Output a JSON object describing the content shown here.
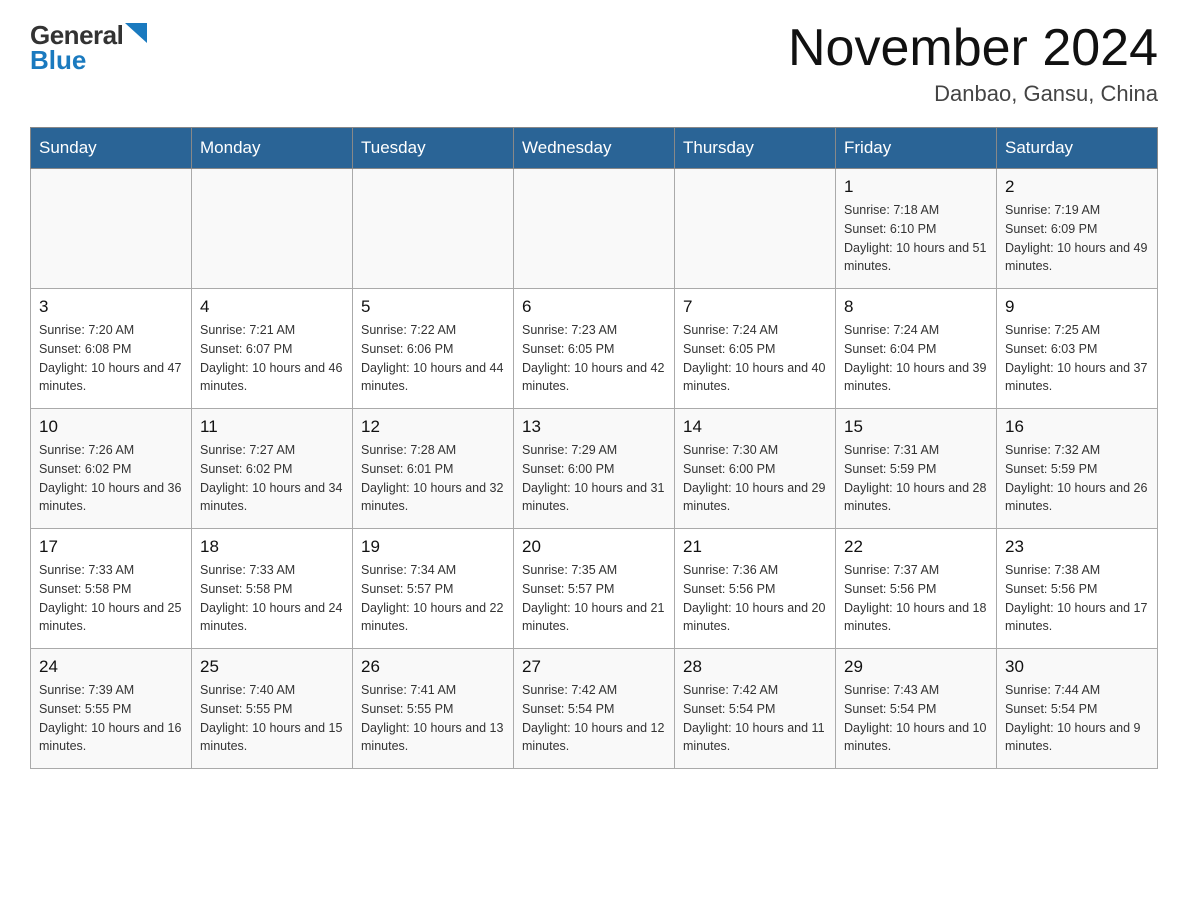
{
  "header": {
    "logo_general": "General",
    "logo_blue": "Blue",
    "month_title": "November 2024",
    "location": "Danbao, Gansu, China"
  },
  "weekdays": [
    "Sunday",
    "Monday",
    "Tuesday",
    "Wednesday",
    "Thursday",
    "Friday",
    "Saturday"
  ],
  "weeks": [
    [
      {
        "day": "",
        "info": ""
      },
      {
        "day": "",
        "info": ""
      },
      {
        "day": "",
        "info": ""
      },
      {
        "day": "",
        "info": ""
      },
      {
        "day": "",
        "info": ""
      },
      {
        "day": "1",
        "info": "Sunrise: 7:18 AM\nSunset: 6:10 PM\nDaylight: 10 hours and 51 minutes."
      },
      {
        "day": "2",
        "info": "Sunrise: 7:19 AM\nSunset: 6:09 PM\nDaylight: 10 hours and 49 minutes."
      }
    ],
    [
      {
        "day": "3",
        "info": "Sunrise: 7:20 AM\nSunset: 6:08 PM\nDaylight: 10 hours and 47 minutes."
      },
      {
        "day": "4",
        "info": "Sunrise: 7:21 AM\nSunset: 6:07 PM\nDaylight: 10 hours and 46 minutes."
      },
      {
        "day": "5",
        "info": "Sunrise: 7:22 AM\nSunset: 6:06 PM\nDaylight: 10 hours and 44 minutes."
      },
      {
        "day": "6",
        "info": "Sunrise: 7:23 AM\nSunset: 6:05 PM\nDaylight: 10 hours and 42 minutes."
      },
      {
        "day": "7",
        "info": "Sunrise: 7:24 AM\nSunset: 6:05 PM\nDaylight: 10 hours and 40 minutes."
      },
      {
        "day": "8",
        "info": "Sunrise: 7:24 AM\nSunset: 6:04 PM\nDaylight: 10 hours and 39 minutes."
      },
      {
        "day": "9",
        "info": "Sunrise: 7:25 AM\nSunset: 6:03 PM\nDaylight: 10 hours and 37 minutes."
      }
    ],
    [
      {
        "day": "10",
        "info": "Sunrise: 7:26 AM\nSunset: 6:02 PM\nDaylight: 10 hours and 36 minutes."
      },
      {
        "day": "11",
        "info": "Sunrise: 7:27 AM\nSunset: 6:02 PM\nDaylight: 10 hours and 34 minutes."
      },
      {
        "day": "12",
        "info": "Sunrise: 7:28 AM\nSunset: 6:01 PM\nDaylight: 10 hours and 32 minutes."
      },
      {
        "day": "13",
        "info": "Sunrise: 7:29 AM\nSunset: 6:00 PM\nDaylight: 10 hours and 31 minutes."
      },
      {
        "day": "14",
        "info": "Sunrise: 7:30 AM\nSunset: 6:00 PM\nDaylight: 10 hours and 29 minutes."
      },
      {
        "day": "15",
        "info": "Sunrise: 7:31 AM\nSunset: 5:59 PM\nDaylight: 10 hours and 28 minutes."
      },
      {
        "day": "16",
        "info": "Sunrise: 7:32 AM\nSunset: 5:59 PM\nDaylight: 10 hours and 26 minutes."
      }
    ],
    [
      {
        "day": "17",
        "info": "Sunrise: 7:33 AM\nSunset: 5:58 PM\nDaylight: 10 hours and 25 minutes."
      },
      {
        "day": "18",
        "info": "Sunrise: 7:33 AM\nSunset: 5:58 PM\nDaylight: 10 hours and 24 minutes."
      },
      {
        "day": "19",
        "info": "Sunrise: 7:34 AM\nSunset: 5:57 PM\nDaylight: 10 hours and 22 minutes."
      },
      {
        "day": "20",
        "info": "Sunrise: 7:35 AM\nSunset: 5:57 PM\nDaylight: 10 hours and 21 minutes."
      },
      {
        "day": "21",
        "info": "Sunrise: 7:36 AM\nSunset: 5:56 PM\nDaylight: 10 hours and 20 minutes."
      },
      {
        "day": "22",
        "info": "Sunrise: 7:37 AM\nSunset: 5:56 PM\nDaylight: 10 hours and 18 minutes."
      },
      {
        "day": "23",
        "info": "Sunrise: 7:38 AM\nSunset: 5:56 PM\nDaylight: 10 hours and 17 minutes."
      }
    ],
    [
      {
        "day": "24",
        "info": "Sunrise: 7:39 AM\nSunset: 5:55 PM\nDaylight: 10 hours and 16 minutes."
      },
      {
        "day": "25",
        "info": "Sunrise: 7:40 AM\nSunset: 5:55 PM\nDaylight: 10 hours and 15 minutes."
      },
      {
        "day": "26",
        "info": "Sunrise: 7:41 AM\nSunset: 5:55 PM\nDaylight: 10 hours and 13 minutes."
      },
      {
        "day": "27",
        "info": "Sunrise: 7:42 AM\nSunset: 5:54 PM\nDaylight: 10 hours and 12 minutes."
      },
      {
        "day": "28",
        "info": "Sunrise: 7:42 AM\nSunset: 5:54 PM\nDaylight: 10 hours and 11 minutes."
      },
      {
        "day": "29",
        "info": "Sunrise: 7:43 AM\nSunset: 5:54 PM\nDaylight: 10 hours and 10 minutes."
      },
      {
        "day": "30",
        "info": "Sunrise: 7:44 AM\nSunset: 5:54 PM\nDaylight: 10 hours and 9 minutes."
      }
    ]
  ]
}
